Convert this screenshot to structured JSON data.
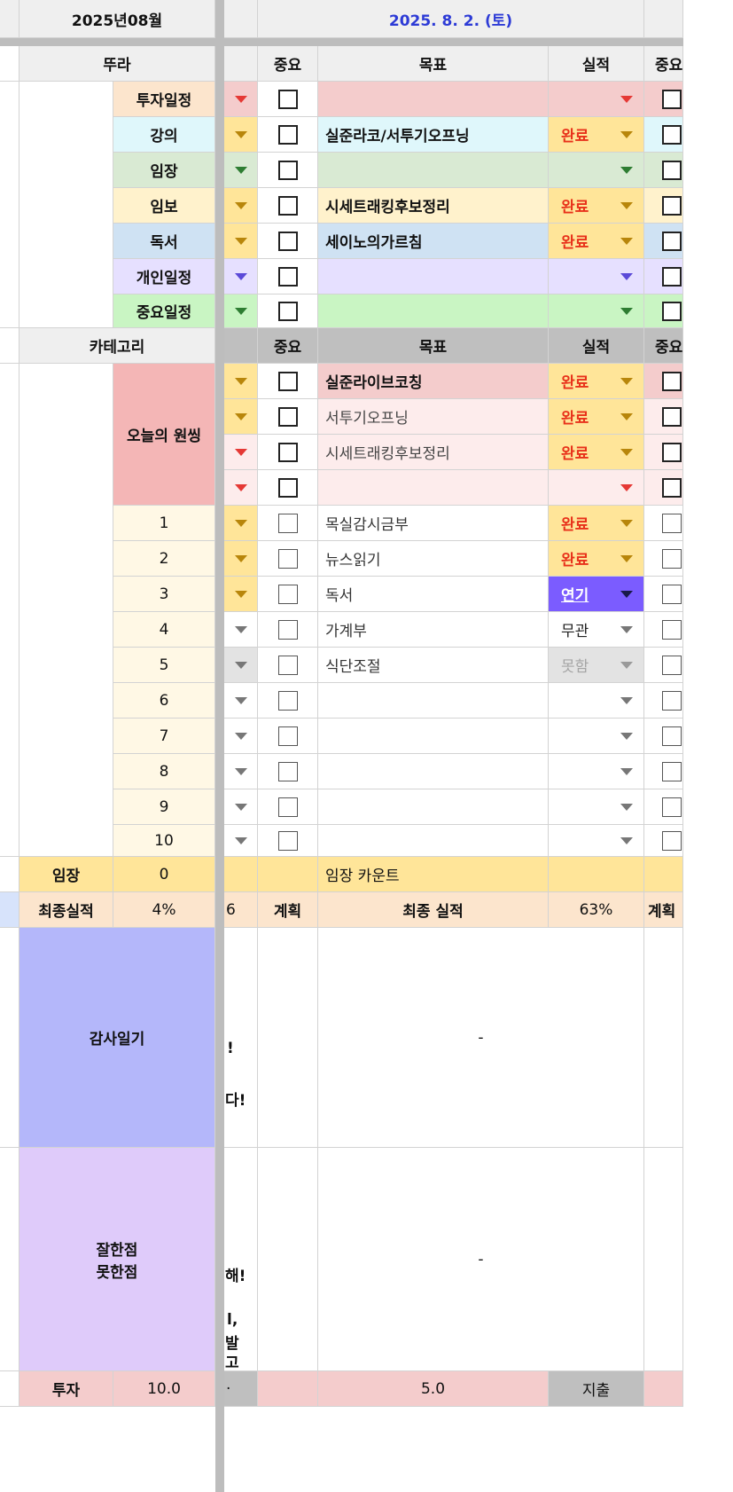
{
  "header": {
    "month": "2025년08월",
    "date": "2025. 8. 2. (토)"
  },
  "cols": {
    "important": "중요",
    "goal": "목표",
    "result": "실적"
  },
  "schedule": {
    "title": "뚜라",
    "items": [
      {
        "label": "투자일정",
        "goal": "",
        "result": ""
      },
      {
        "label": "강의",
        "goal": "실준라코/서투기오프닝",
        "result": "완료"
      },
      {
        "label": "임장",
        "goal": "",
        "result": ""
      },
      {
        "label": "임보",
        "goal": "시세트래킹후보정리",
        "result": "완료"
      },
      {
        "label": "독서",
        "goal": "세이노의가르침",
        "result": "완료"
      },
      {
        "label": "개인일정",
        "goal": "",
        "result": ""
      },
      {
        "label": "중요일정",
        "goal": "",
        "result": ""
      }
    ]
  },
  "category": {
    "title": "카테고리",
    "oneThing": "오늘의 원씽",
    "oneThingRows": [
      {
        "goal": "실준라이브코칭",
        "result": "완료"
      },
      {
        "goal": "서투기오프닝",
        "result": "완료"
      },
      {
        "goal": "시세트래킹후보정리",
        "result": "완료"
      },
      {
        "goal": "",
        "result": ""
      }
    ],
    "rows": [
      {
        "n": "1",
        "goal": "목실감시금부",
        "result": "완료"
      },
      {
        "n": "2",
        "goal": "뉴스읽기",
        "result": "완료"
      },
      {
        "n": "3",
        "goal": "독서",
        "result": "연기"
      },
      {
        "n": "4",
        "goal": "가계부",
        "result": "무관"
      },
      {
        "n": "5",
        "goal": "식단조절",
        "result": "못함"
      },
      {
        "n": "6",
        "goal": "",
        "result": ""
      },
      {
        "n": "7",
        "goal": "",
        "result": ""
      },
      {
        "n": "8",
        "goal": "",
        "result": ""
      },
      {
        "n": "9",
        "goal": "",
        "result": ""
      },
      {
        "n": "10",
        "goal": "",
        "result": ""
      }
    ]
  },
  "imjang": {
    "label": "임장",
    "count": "0",
    "countLabel": "임장 카운트"
  },
  "summary": {
    "label": "최종실적",
    "pct": "4%",
    "pctFrag": "6",
    "plan": "계획",
    "finalLabel": "최종 실적",
    "finalPct": "63%",
    "planNext": "계획"
  },
  "gratitude": {
    "label": "감사일기",
    "value": "-",
    "frag1": "!",
    "frag2": "다!"
  },
  "review": {
    "label1": "잘한점",
    "label2": "못한점",
    "value": "-",
    "frag1": "해!",
    "frag2": "l,",
    "frag3": "발",
    "frag4": "고"
  },
  "invest": {
    "label": "투자",
    "val1": "10.0",
    "val2": "5.0",
    "spend": "지출",
    "frag": "·"
  },
  "colors": {
    "done": "#e8311a",
    "delay": "#7b5cff",
    "frozen": "#bdbdbd"
  }
}
